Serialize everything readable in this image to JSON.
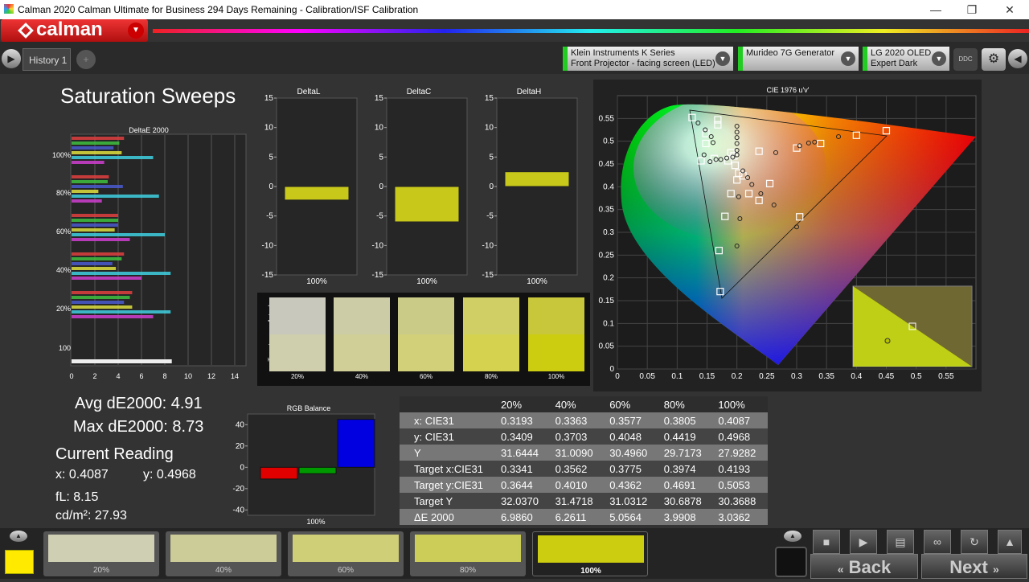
{
  "window": {
    "title": "Calman 2020 Calman Ultimate for Business 294 Days Remaining - Calibration/ISF Calibration"
  },
  "app": {
    "logo_text": "calman"
  },
  "toolbar": {
    "history_tab": "History 1",
    "devices": [
      {
        "line1": "Klein Instruments K Series",
        "line2": "Front Projector - facing screen (LED)"
      },
      {
        "line1": "Murideo 7G Generator",
        "line2": ""
      },
      {
        "line1": "LG 2020 OLED",
        "line2": "Expert Dark"
      }
    ],
    "ddc_label": "DDC"
  },
  "page": {
    "title": "Saturation Sweeps"
  },
  "deltae_chart": {
    "title": "DeltaE 2000",
    "y_labels": [
      "100%",
      "80%",
      "60%",
      "40%",
      "20%",
      "100"
    ],
    "x_ticks": [
      "0",
      "2",
      "4",
      "6",
      "8",
      "10",
      "12",
      "14"
    ]
  },
  "delta_charts": [
    {
      "title": "DeltaL",
      "ticks": [
        "15",
        "10",
        "5",
        "0",
        "-5",
        "-10",
        "-15"
      ],
      "x_label": "100%"
    },
    {
      "title": "DeltaC",
      "ticks": [
        "15",
        "10",
        "5",
        "0",
        "-5",
        "-10",
        "-15"
      ],
      "x_label": "100%"
    },
    {
      "title": "DeltaH",
      "ticks": [
        "15",
        "10",
        "5",
        "0",
        "-5",
        "-10",
        "-15"
      ],
      "x_label": "100%"
    }
  ],
  "swatches": {
    "actual_label": "Actual",
    "target_label": "Target",
    "labels": [
      "20%",
      "40%",
      "60%",
      "80%",
      "100%"
    ]
  },
  "cie": {
    "title": "CIE 1976 u'v'",
    "x_ticks": [
      "0",
      "0.05",
      "0.1",
      "0.15",
      "0.2",
      "0.25",
      "0.3",
      "0.35",
      "0.4",
      "0.45",
      "0.5",
      "0.55"
    ],
    "y_ticks": [
      "0.55",
      "0.5",
      "0.45",
      "0.4",
      "0.35",
      "0.3",
      "0.25",
      "0.2",
      "0.15",
      "0.1",
      "0.05",
      "0"
    ]
  },
  "stats": {
    "avg": "Avg dE2000: 4.91",
    "max": "Max dE2000: 8.73",
    "current_heading": "Current Reading",
    "x": "x: 0.4087",
    "y": "y: 0.4968",
    "fl": "fL: 8.15",
    "cdm2": "cd/m²: 27.93"
  },
  "rgb_balance": {
    "title": "RGB Balance",
    "ticks": [
      "40",
      "20",
      "0",
      "-20",
      "-40"
    ],
    "x_label": "100%",
    "chart_data": {
      "type": "bar",
      "categories": [
        "R",
        "G",
        "B"
      ],
      "values": [
        -11,
        -6,
        45
      ],
      "ylim": [
        -45,
        50
      ]
    }
  },
  "table": {
    "headers": [
      "",
      "20%",
      "40%",
      "60%",
      "80%",
      "100%"
    ],
    "rows": [
      [
        "x: CIE31",
        "0.3193",
        "0.3363",
        "0.3577",
        "0.3805",
        "0.4087"
      ],
      [
        "y: CIE31",
        "0.3409",
        "0.3703",
        "0.4048",
        "0.4419",
        "0.4968"
      ],
      [
        "Y",
        "31.6444",
        "31.0090",
        "30.4960",
        "29.7173",
        "27.9282"
      ],
      [
        "Target x:CIE31",
        "0.3341",
        "0.3562",
        "0.3775",
        "0.3974",
        "0.4193"
      ],
      [
        "Target y:CIE31",
        "0.3644",
        "0.4010",
        "0.4362",
        "0.4691",
        "0.5053"
      ],
      [
        "Target Y",
        "32.0370",
        "31.4718",
        "31.0312",
        "30.6878",
        "30.3688"
      ],
      [
        "ΔE 2000",
        "6.9860",
        "6.2611",
        "5.0564",
        "3.9908",
        "3.0362"
      ]
    ]
  },
  "patches": [
    "20%",
    "40%",
    "60%",
    "80%",
    "100%"
  ],
  "nav": {
    "back": "Back",
    "next": "Next"
  },
  "colors": {
    "accent_red": "#e02020",
    "yellow_bar": "#c8c81a",
    "patch_yellow": "#ffea00"
  },
  "chart_data": [
    {
      "type": "bar",
      "title": "DeltaL",
      "categories": [
        "100%"
      ],
      "values": [
        -2.3
      ],
      "ylim": [
        -15,
        15
      ]
    },
    {
      "type": "bar",
      "title": "DeltaC",
      "categories": [
        "100%"
      ],
      "values": [
        -6
      ],
      "ylim": [
        -15,
        15
      ]
    },
    {
      "type": "bar",
      "title": "DeltaH",
      "categories": [
        "100%"
      ],
      "values": [
        2.5
      ],
      "ylim": [
        -15,
        15
      ]
    }
  ]
}
